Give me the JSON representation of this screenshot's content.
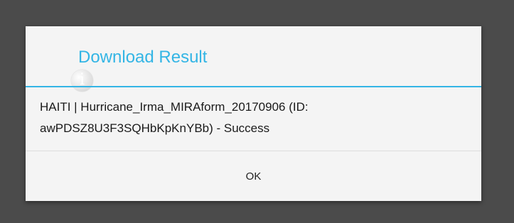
{
  "dialog": {
    "title": "Download Result",
    "title_icon": "info-icon",
    "message": "HAITI | Hurricane_Irma_MIRAform_20170906 (ID: awPDSZ8U3F3SQHbKpKnYBb) - Success",
    "ok_label": "OK"
  },
  "colors": {
    "accent": "#33b5e5",
    "backdrop": "#4b4b4b",
    "dialog_background": "#f4f4f4"
  }
}
